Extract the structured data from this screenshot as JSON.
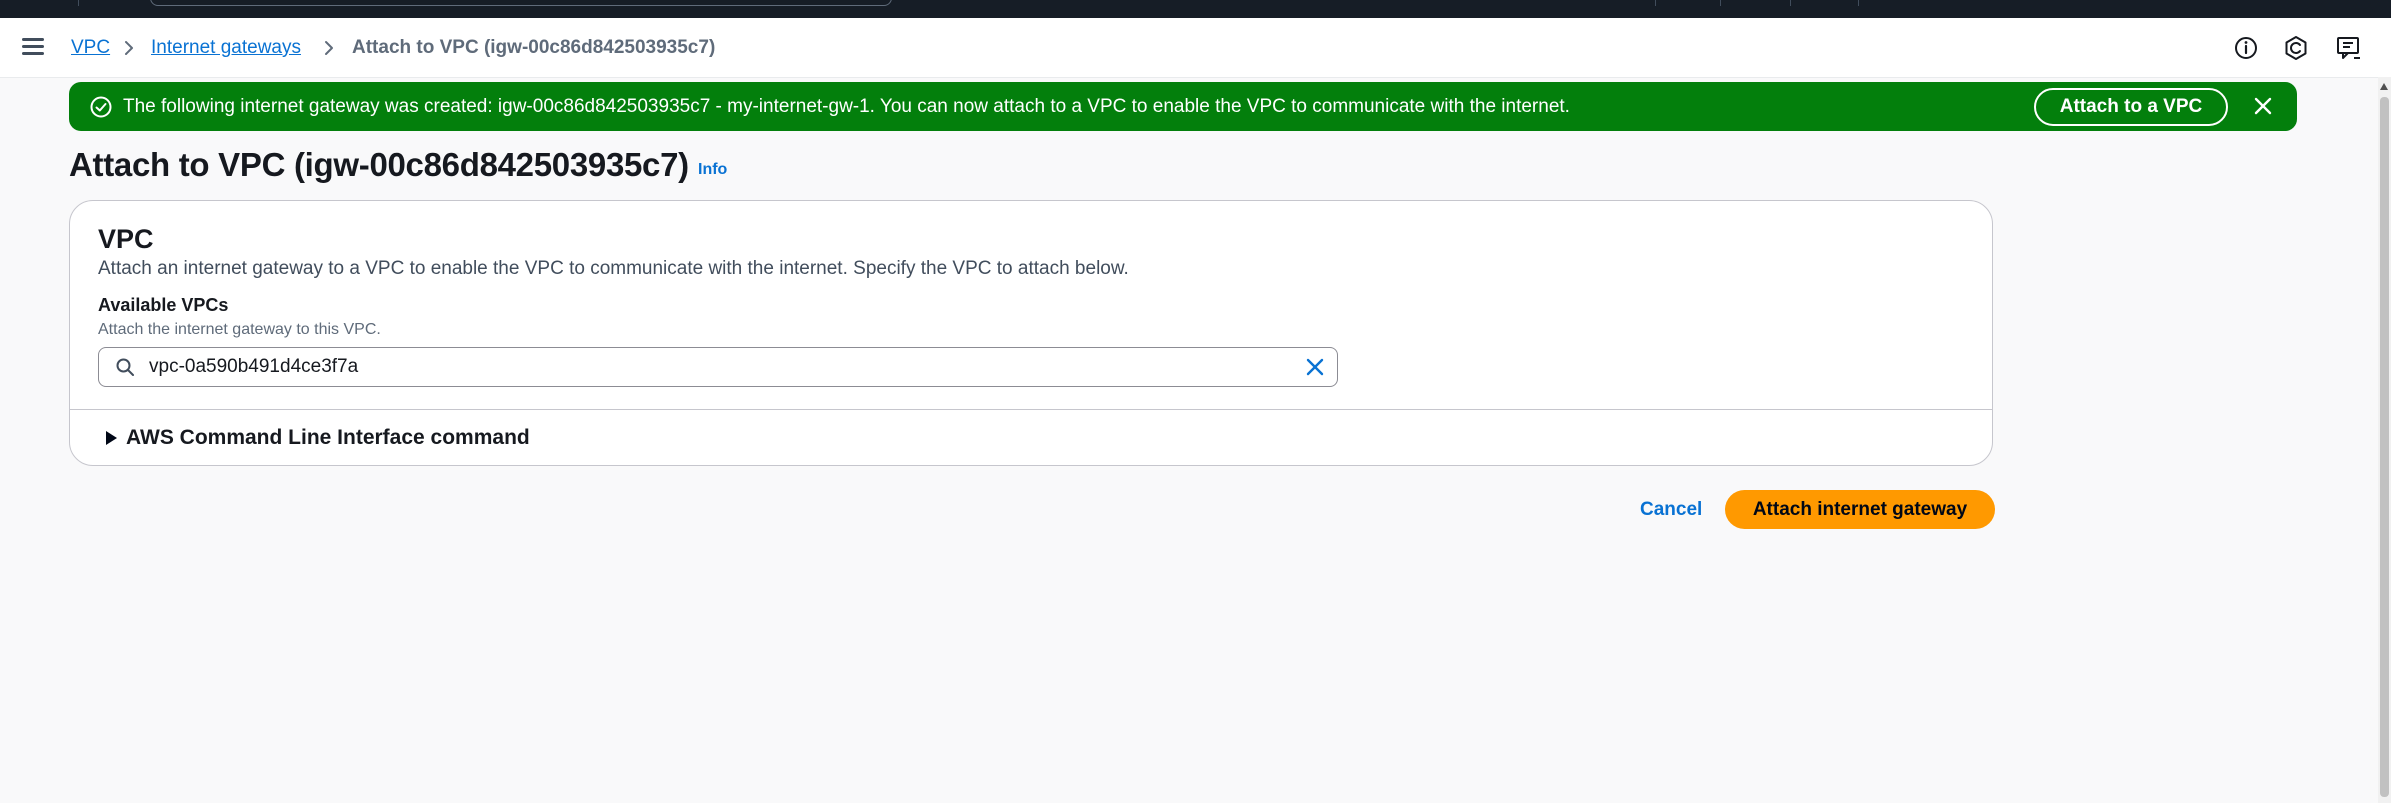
{
  "breadcrumb": {
    "items": [
      {
        "label": "VPC"
      },
      {
        "label": "Internet gateways"
      },
      {
        "label": "Attach to VPC (igw-00c86d842503935c7)"
      }
    ]
  },
  "flash": {
    "message": "The following internet gateway was created: igw-00c86d842503935c7 - my-internet-gw-1. You can now attach to a VPC to enable the VPC to communicate with the internet.",
    "action_label": "Attach to a VPC",
    "status_color": "#037f0c"
  },
  "page": {
    "title": "Attach to VPC (igw-00c86d842503935c7)",
    "info_label": "Info"
  },
  "panel": {
    "title": "VPC",
    "description": "Attach an internet gateway to a VPC to enable the VPC to communicate with the internet. Specify the VPC to attach below.",
    "field_label": "Available VPCs",
    "field_description": "Attach the internet gateway to this VPC.",
    "field_value": "vpc-0a590b491d4ce3f7a",
    "cli_label": "AWS Command Line Interface command"
  },
  "actions": {
    "cancel_label": "Cancel",
    "primary_label": "Attach internet gateway",
    "primary_color": "#ff9900"
  },
  "icons": {
    "menu": "hamburger-menu-icon",
    "info": "info-circle-icon",
    "notifications": "notification-icon",
    "feedback": "feedback-icon",
    "success": "check-circle-icon",
    "close": "close-icon",
    "search": "search-icon",
    "clear": "clear-x-icon"
  }
}
